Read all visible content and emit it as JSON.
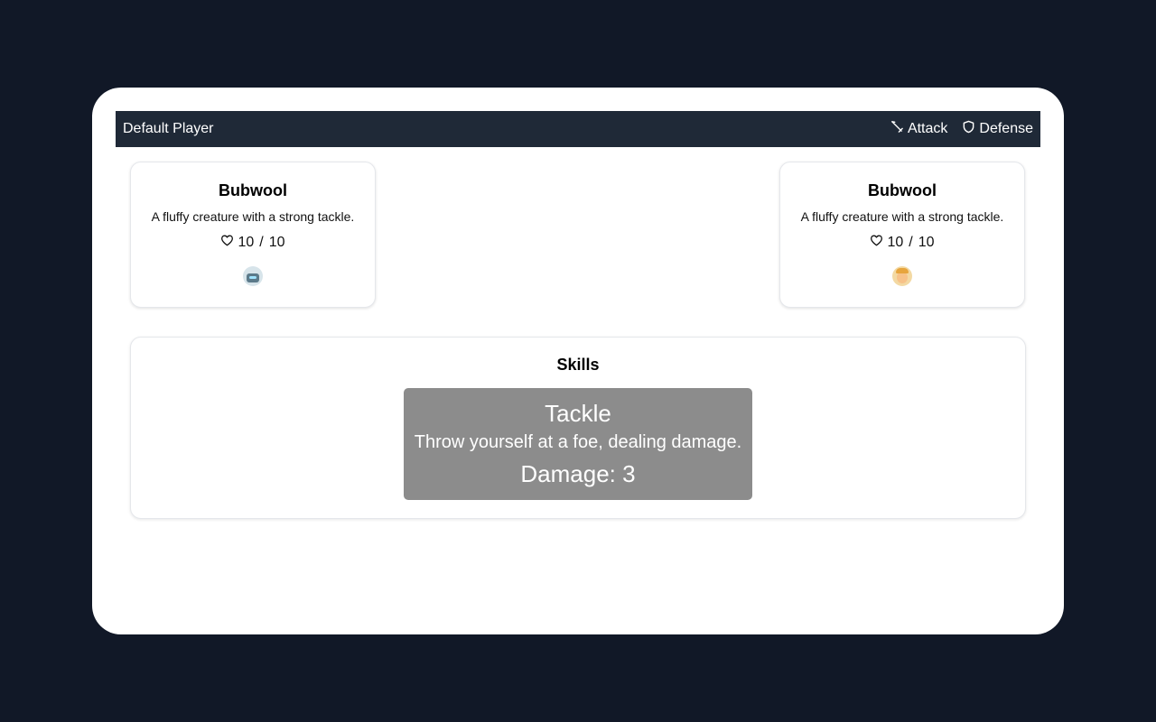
{
  "header": {
    "player_name": "Default Player",
    "attack_label": "Attack",
    "defense_label": "Defense"
  },
  "player_creature": {
    "name": "Bubwool",
    "description": "A fluffy creature with a strong tackle.",
    "hp_current": "10",
    "hp_max": "10",
    "avatar_icon": "robot-face-icon"
  },
  "enemy_creature": {
    "name": "Bubwool",
    "description": "A fluffy creature with a strong tackle.",
    "hp_current": "10",
    "hp_max": "10",
    "avatar_icon": "person-face-icon"
  },
  "skills": {
    "title": "Skills",
    "items": [
      {
        "name": "Tackle",
        "description": "Throw yourself at a foe, dealing damage.",
        "damage_text": "Damage: 3"
      }
    ]
  },
  "colors": {
    "background": "#111827",
    "topbar": "#1f2937",
    "skill_card": "#8c8c8c"
  }
}
